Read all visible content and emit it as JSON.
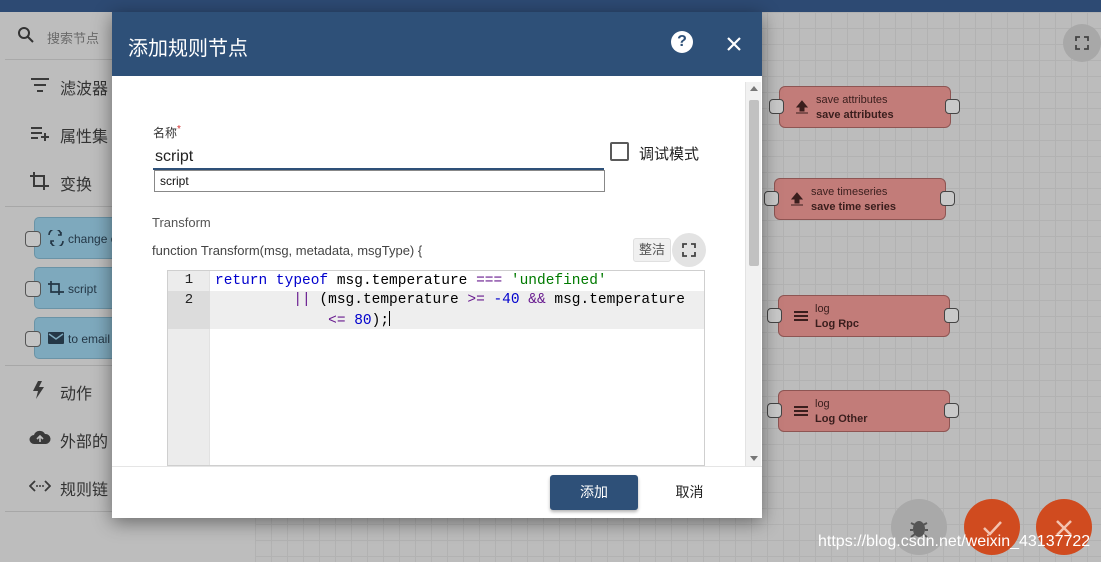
{
  "sidebar": {
    "search_placeholder": "搜索节点",
    "categories": [
      {
        "label": "滤波器",
        "icon": "filter-icon"
      },
      {
        "label": "属性集",
        "icon": "playlist-add-icon"
      },
      {
        "label": "变换",
        "icon": "crop-icon"
      },
      {
        "label": "动作",
        "icon": "flash-icon"
      },
      {
        "label": "外部的",
        "icon": "cloud-upload-icon"
      },
      {
        "label": "规则链",
        "icon": "code-arrows-icon"
      }
    ],
    "transform_nodes": [
      {
        "label": "change o",
        "icon": "swap-icon"
      },
      {
        "label": "script",
        "icon": "crop-icon"
      },
      {
        "label": "to email",
        "icon": "email-icon"
      }
    ]
  },
  "canvas": {
    "nodes": [
      {
        "type": "save attributes",
        "name": "save attributes",
        "icon": "upload-icon"
      },
      {
        "type": "save timeseries",
        "name": "save time series",
        "icon": "upload-icon"
      },
      {
        "type": "log",
        "name": "Log Rpc",
        "icon": "menu-icon"
      },
      {
        "type": "log",
        "name": "Log Other",
        "icon": "menu-icon"
      }
    ]
  },
  "dialog": {
    "title": "添加规则节点",
    "name_label": "名称",
    "required_mark": "*",
    "name_value": "script",
    "autocomplete_option": "script",
    "debug_label": "调试模式",
    "debug_checked": false,
    "transform_label": "Transform",
    "function_signature": "function Transform(msg, metadata, msgType) {",
    "tidy_label": "整洁",
    "code": {
      "line_numbers": [
        "1",
        "2"
      ],
      "line1": {
        "kw1": "return",
        "kw2": "typeof",
        "text1": " msg.temperature ",
        "op1": "===",
        "str": "'undefined'"
      },
      "line2": {
        "op1": "||",
        "text1": " (msg.temperature ",
        "op2": ">=",
        "num1": "-40",
        "op3": "&&",
        "text2": " msg.temperature"
      },
      "line3": {
        "op1": "<=",
        "num1": "80",
        "text1": ");"
      }
    },
    "add_label": "添加",
    "cancel_label": "取消"
  },
  "watermark": "https://blog.csdn.net/weixin_43137722",
  "colors": {
    "header": "#2e5078",
    "node_red": "#c27c79",
    "node_blue": "#7ea9bd",
    "fab_orange": "#d04b1f"
  }
}
